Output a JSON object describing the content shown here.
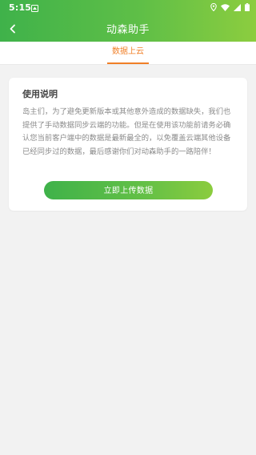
{
  "status_bar": {
    "time": "5:15",
    "icons": [
      "notification-icon",
      "location-icon",
      "wifi-icon",
      "signal-icon",
      "battery-icon"
    ]
  },
  "app_bar": {
    "title": "动森助手",
    "back_icon": "back-arrow-icon"
  },
  "tabs": [
    {
      "label": "数据上云",
      "active": true
    }
  ],
  "card": {
    "title": "使用说明",
    "body": "岛主们，为了避免更新版本或其他意外造成的数据缺失，我们也提供了手动数据同步云端的功能。但是在使用该功能前请务必确认您当前客户端中的数据是最新最全的，以免覆盖云端其他设备已经同步过的数据，最后感谢你们对动森助手的一路陪伴！",
    "button_label": "立即上传数据"
  },
  "colors": {
    "header_gradient_start": "#3fb24a",
    "header_gradient_end": "#8ccd3f",
    "tab_active": "#f07f27",
    "background": "#f2f2f2",
    "card_text": "#8b8b8b"
  }
}
